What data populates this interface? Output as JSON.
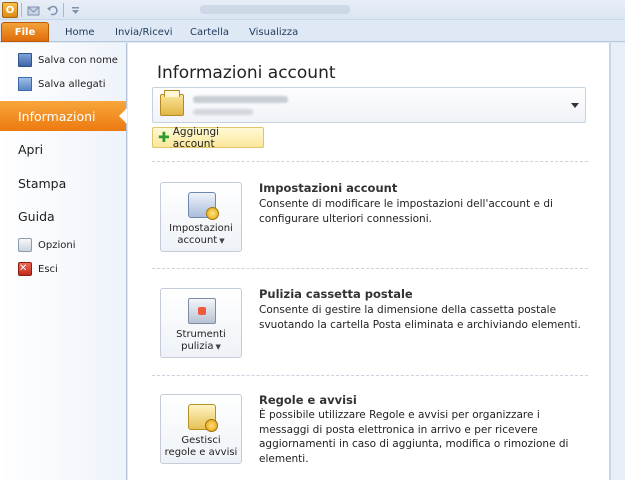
{
  "app": {
    "accent": "#ec7a10",
    "logo_letter": "O"
  },
  "ribbon": {
    "tabs": [
      {
        "label": "File"
      },
      {
        "label": "Home"
      },
      {
        "label": "Invia/Ricevi"
      },
      {
        "label": "Cartella"
      },
      {
        "label": "Visualizza"
      }
    ]
  },
  "nav": {
    "save_as": "Salva con nome",
    "save_attachments": "Salva allegati",
    "info": "Informazioni",
    "open": "Apri",
    "print": "Stampa",
    "help": "Guida",
    "options": "Opzioni",
    "exit": "Esci",
    "exit_glyph": "✕"
  },
  "main": {
    "title": "Informazioni account",
    "add_account_label": "Aggiungi account",
    "add_account_glyph": "✚",
    "sections": [
      {
        "button_line1": "Impostazioni",
        "button_line2": "account",
        "title": "Impostazioni account",
        "description": "Consente di modificare le impostazioni dell'account e di configurare ulteriori connessioni."
      },
      {
        "button_line1": "Strumenti",
        "button_line2": "pulizia",
        "title": "Pulizia cassetta postale",
        "description": "Consente di gestire la dimensione della cassetta postale svuotando la cartella Posta eliminata e archiviando elementi."
      },
      {
        "button_line1": "Gestisci",
        "button_line2": "regole e avvisi",
        "title": "Regole e avvisi",
        "description": "È possibile utilizzare Regole e avvisi per organizzare i messaggi di posta elettronica in arrivo e per ricevere aggiornamenti in caso di aggiunta, modifica o rimozione di elementi."
      }
    ]
  }
}
